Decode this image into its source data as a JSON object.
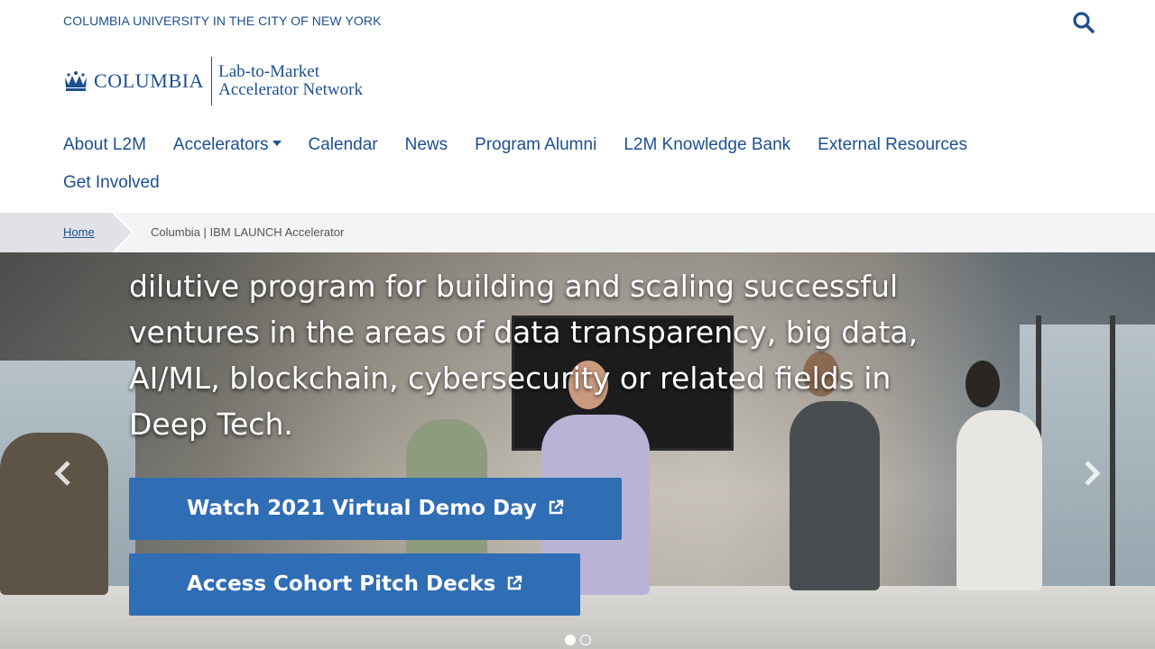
{
  "header": {
    "university_link": "COLUMBIA UNIVERSITY IN THE CITY OF NEW YORK",
    "logo_wordmark": "Columbia",
    "logo_subtitle_line1": "Lab-to-Market",
    "logo_subtitle_line2": "Accelerator Network",
    "search_icon": "search-icon"
  },
  "nav": {
    "items": [
      {
        "label": "About L2M"
      },
      {
        "label": "Accelerators",
        "has_dropdown": true
      },
      {
        "label": "Calendar"
      },
      {
        "label": "News"
      },
      {
        "label": "Program Alumni"
      },
      {
        "label": "L2M Knowledge Bank"
      },
      {
        "label": "External Resources"
      },
      {
        "label": "Get Involved"
      }
    ]
  },
  "breadcrumb": {
    "home": "Home",
    "current": "Columbia | IBM LAUNCH Accelerator"
  },
  "hero": {
    "text": "dilutive program for building and scaling successful ventures in the areas of data transparency, big data, AI/ML, blockchain, cybersecurity or related fields in Deep Tech.",
    "cta_demo_day": "Watch 2021 Virtual Demo Day",
    "cta_pitch_decks": "Access Cohort Pitch Decks",
    "slide_count": 2,
    "active_slide": 1
  },
  "colors": {
    "brand": "#1d4f91",
    "cta": "#2f6db5"
  }
}
